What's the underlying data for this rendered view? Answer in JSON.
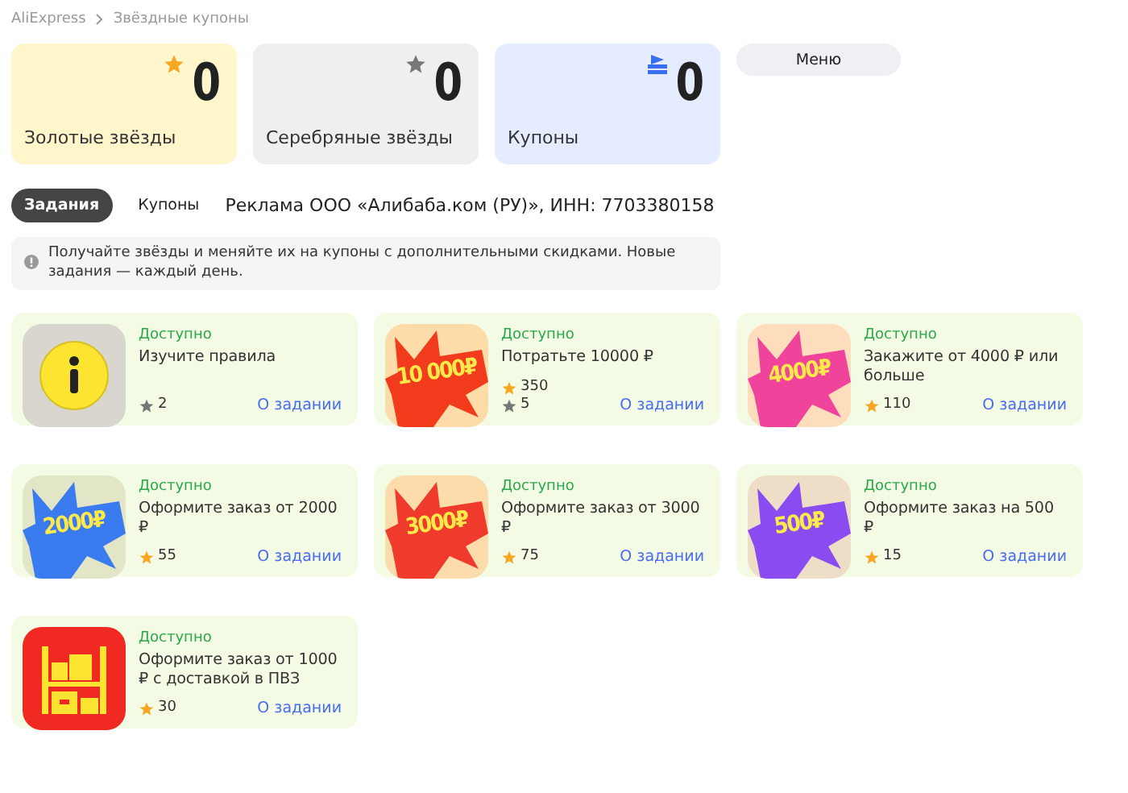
{
  "breadcrumbs": [
    {
      "label": "AliExpress"
    },
    {
      "label": "Звёздные купоны"
    }
  ],
  "balances": [
    {
      "kind": "gold",
      "value": "0",
      "label": "Золотые звёзды"
    },
    {
      "kind": "silver",
      "value": "0",
      "label": "Серебряные звёзды"
    },
    {
      "kind": "coupon",
      "value": "0",
      "label": "Купоны"
    }
  ],
  "menu_button": "Меню",
  "tabs": [
    {
      "label": "Задания",
      "selected": true
    },
    {
      "label": "Купоны",
      "selected": false
    }
  ],
  "ad_notice": "Реклама ООО «Алибаба.ком (РУ)», ИНН: 7703380158",
  "info_banner": "Получайте звёзды и меняйте их на купоны с дополнительными скидками. Новые задания — каждый день.",
  "tasks": [
    {
      "status": "Доступно",
      "title": "Изучите правила",
      "image": {
        "kind": "info"
      },
      "rewards": [
        {
          "kind": "silver",
          "amount": "2"
        }
      ],
      "link": "О задании"
    },
    {
      "status": "Доступно",
      "title": "Потратьте 10000 ₽",
      "image": {
        "kind": "burst",
        "label": "10 000₽",
        "color": "#f23a1c"
      },
      "rewards": [
        {
          "kind": "gold",
          "amount": "350"
        },
        {
          "kind": "silver",
          "amount": "5"
        }
      ],
      "link": "О задании"
    },
    {
      "status": "Доступно",
      "title": "Закажите от 4000 ₽ или больше",
      "image": {
        "kind": "burst",
        "label": "4000₽",
        "color": "#f0449c"
      },
      "rewards": [
        {
          "kind": "gold",
          "amount": "110"
        }
      ],
      "link": "О задании"
    },
    {
      "status": "Доступно",
      "title": "Оформите заказ от 2000 ₽",
      "image": {
        "kind": "burst",
        "label": "2000₽",
        "color": "#3a7bf0"
      },
      "rewards": [
        {
          "kind": "gold",
          "amount": "55"
        }
      ],
      "link": "О задании"
    },
    {
      "status": "Доступно",
      "title": "Оформите заказ от 3000 ₽",
      "image": {
        "kind": "burst",
        "label": "3000₽",
        "color": "#f03a2c"
      },
      "rewards": [
        {
          "kind": "gold",
          "amount": "75"
        }
      ],
      "link": "О задании"
    },
    {
      "status": "Доступно",
      "title": "Оформите заказ на 500 ₽",
      "image": {
        "kind": "burst",
        "label": "500₽",
        "color": "#8a4cf0"
      },
      "rewards": [
        {
          "kind": "gold",
          "amount": "15"
        }
      ],
      "link": "О задании"
    },
    {
      "status": "Доступно",
      "title": "Оформите заказ от 1000 ₽ с доставкой в ПВЗ",
      "image": {
        "kind": "shelf"
      },
      "rewards": [
        {
          "kind": "gold",
          "amount": "30"
        }
      ],
      "link": "О задании"
    }
  ]
}
